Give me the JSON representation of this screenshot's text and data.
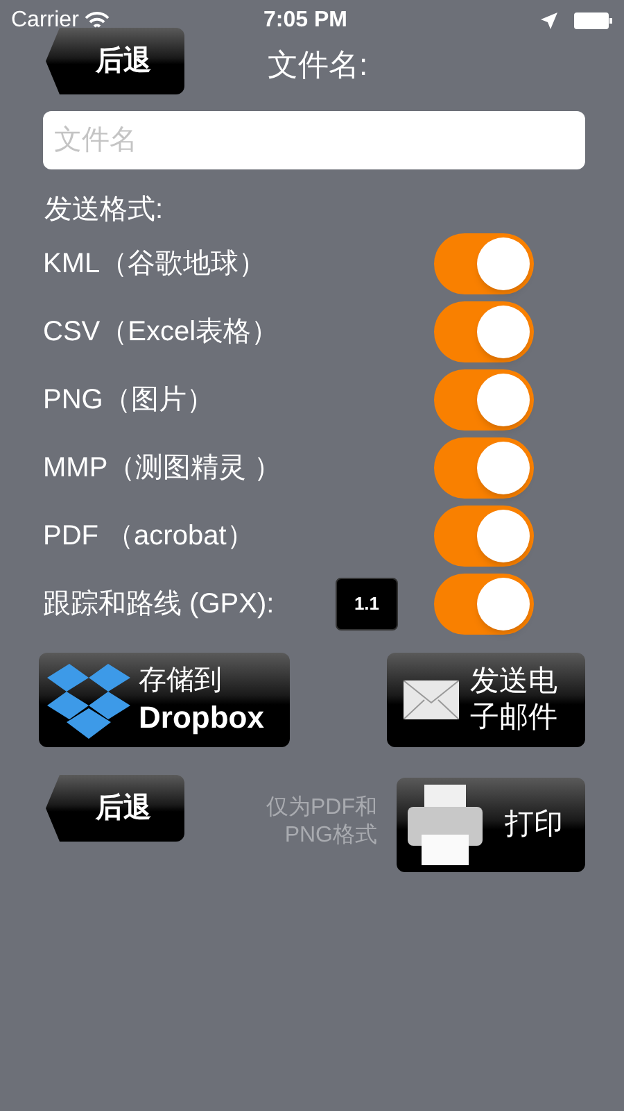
{
  "status_bar": {
    "carrier": "Carrier",
    "time": "7:05 PM"
  },
  "header": {
    "back_button": "后退",
    "title": "文件名:"
  },
  "filename_field": {
    "placeholder": "文件名"
  },
  "formats_heading": "发送格式:",
  "formats": [
    {
      "label": "KML（谷歌地球）",
      "on": true
    },
    {
      "label": "CSV（Excel表格）",
      "on": true
    },
    {
      "label": "PNG（图片）",
      "on": true
    },
    {
      "label": "MMP（测图精灵 ）",
      "on": true
    },
    {
      "label": "PDF （acrobat）",
      "on": true
    },
    {
      "label": "跟踪和路线 (GPX):",
      "on": true,
      "version_button": "1.1"
    }
  ],
  "dropbox_button": {
    "line1": "存储到",
    "line2": "Dropbox"
  },
  "email_button": {
    "line1": "发送电",
    "line2": "子邮件"
  },
  "footer_back_button": "后退",
  "print_note": {
    "line1": "仅为PDF和",
    "line2": "PNG格式"
  },
  "print_button": "打印"
}
